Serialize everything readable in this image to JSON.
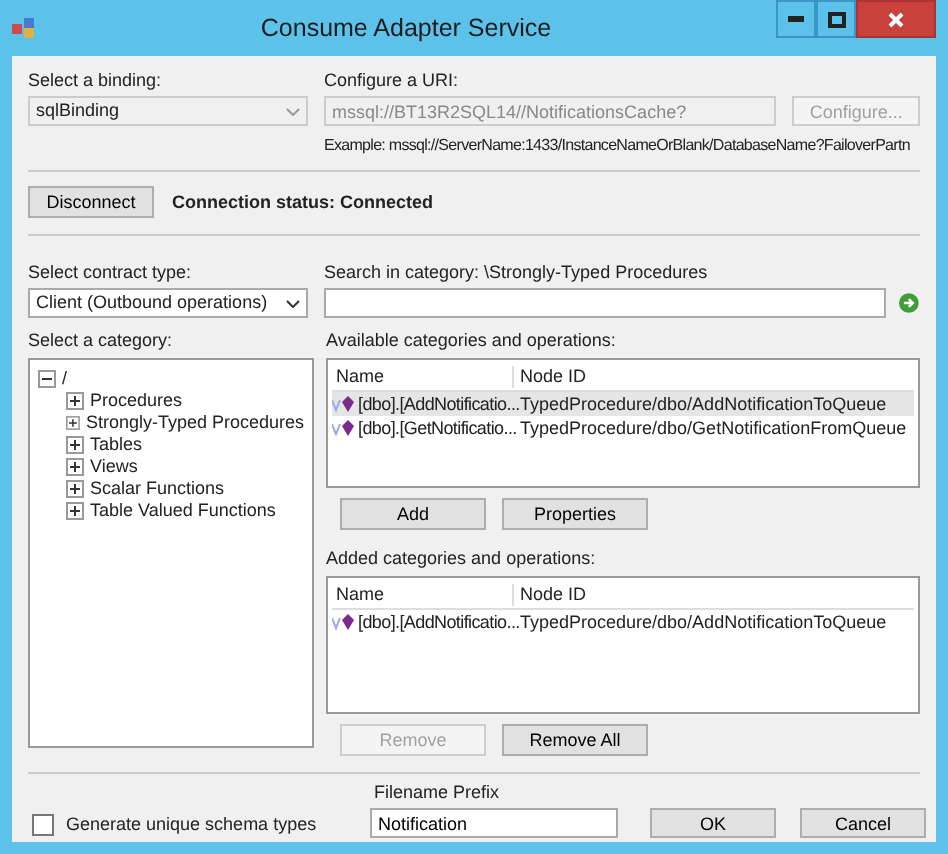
{
  "window": {
    "title": "Consume Adapter Service"
  },
  "binding": {
    "label": "Select a binding:",
    "value": "sqlBinding",
    "disabled": true
  },
  "uri": {
    "label": "Configure a URI:",
    "value": "mssql://BT13R2SQL14//NotificationsCache?",
    "disabled": true,
    "configure_button": {
      "label": "Configure...",
      "disabled": true
    },
    "example": "Example: mssql://ServerName:1433/InstanceNameOrBlank/DatabaseName?FailoverPartn"
  },
  "connection": {
    "button": "Disconnect",
    "status": "Connection status: Connected"
  },
  "contract_type": {
    "label": "Select contract type:",
    "value": "Client (Outbound operations)"
  },
  "search": {
    "label": "Search in category: \\Strongly-Typed Procedures"
  },
  "category": {
    "label": "Select a category:",
    "tree": [
      {
        "label": "/",
        "expanded": true,
        "children": [
          {
            "label": "Procedures",
            "expanded": false
          },
          {
            "label": "Strongly-Typed Procedures",
            "expanded": false
          },
          {
            "label": "Tables",
            "expanded": false
          },
          {
            "label": "Views",
            "expanded": false
          },
          {
            "label": "Scalar Functions",
            "expanded": false
          },
          {
            "label": "Table Valued Functions",
            "expanded": false
          }
        ]
      }
    ]
  },
  "available": {
    "label": "Available categories and operations:",
    "columns": [
      "Name",
      "Node ID"
    ],
    "rows": [
      {
        "name": "[dbo].[AddNotificatio...",
        "node_id": "TypedProcedure/dbo/AddNotificationToQueue",
        "selected": true
      },
      {
        "name": "[dbo].[GetNotificatio...",
        "node_id": "TypedProcedure/dbo/GetNotificationFromQueue",
        "selected": false
      }
    ],
    "buttons": [
      {
        "label": "Add",
        "disabled": false
      },
      {
        "label": "Properties",
        "disabled": false
      }
    ]
  },
  "added": {
    "label": "Added categories and operations:",
    "columns": [
      "Name",
      "Node ID"
    ],
    "rows": [
      {
        "name": "[dbo].[AddNotificatio...",
        "node_id": "TypedProcedure/dbo/AddNotificationToQueue",
        "selected": false
      }
    ],
    "buttons": [
      {
        "label": "Remove",
        "disabled": true
      },
      {
        "label": "Remove All",
        "disabled": false
      }
    ]
  },
  "unique_schema_types": {
    "label": "Generate unique schema types",
    "checked": false
  },
  "filename_prefix": {
    "label": "Filename Prefix",
    "value": "Notification"
  },
  "buttons": [
    {
      "label": "OK",
      "disabled": false
    },
    {
      "label": "Cancel",
      "disabled": false
    }
  ]
}
